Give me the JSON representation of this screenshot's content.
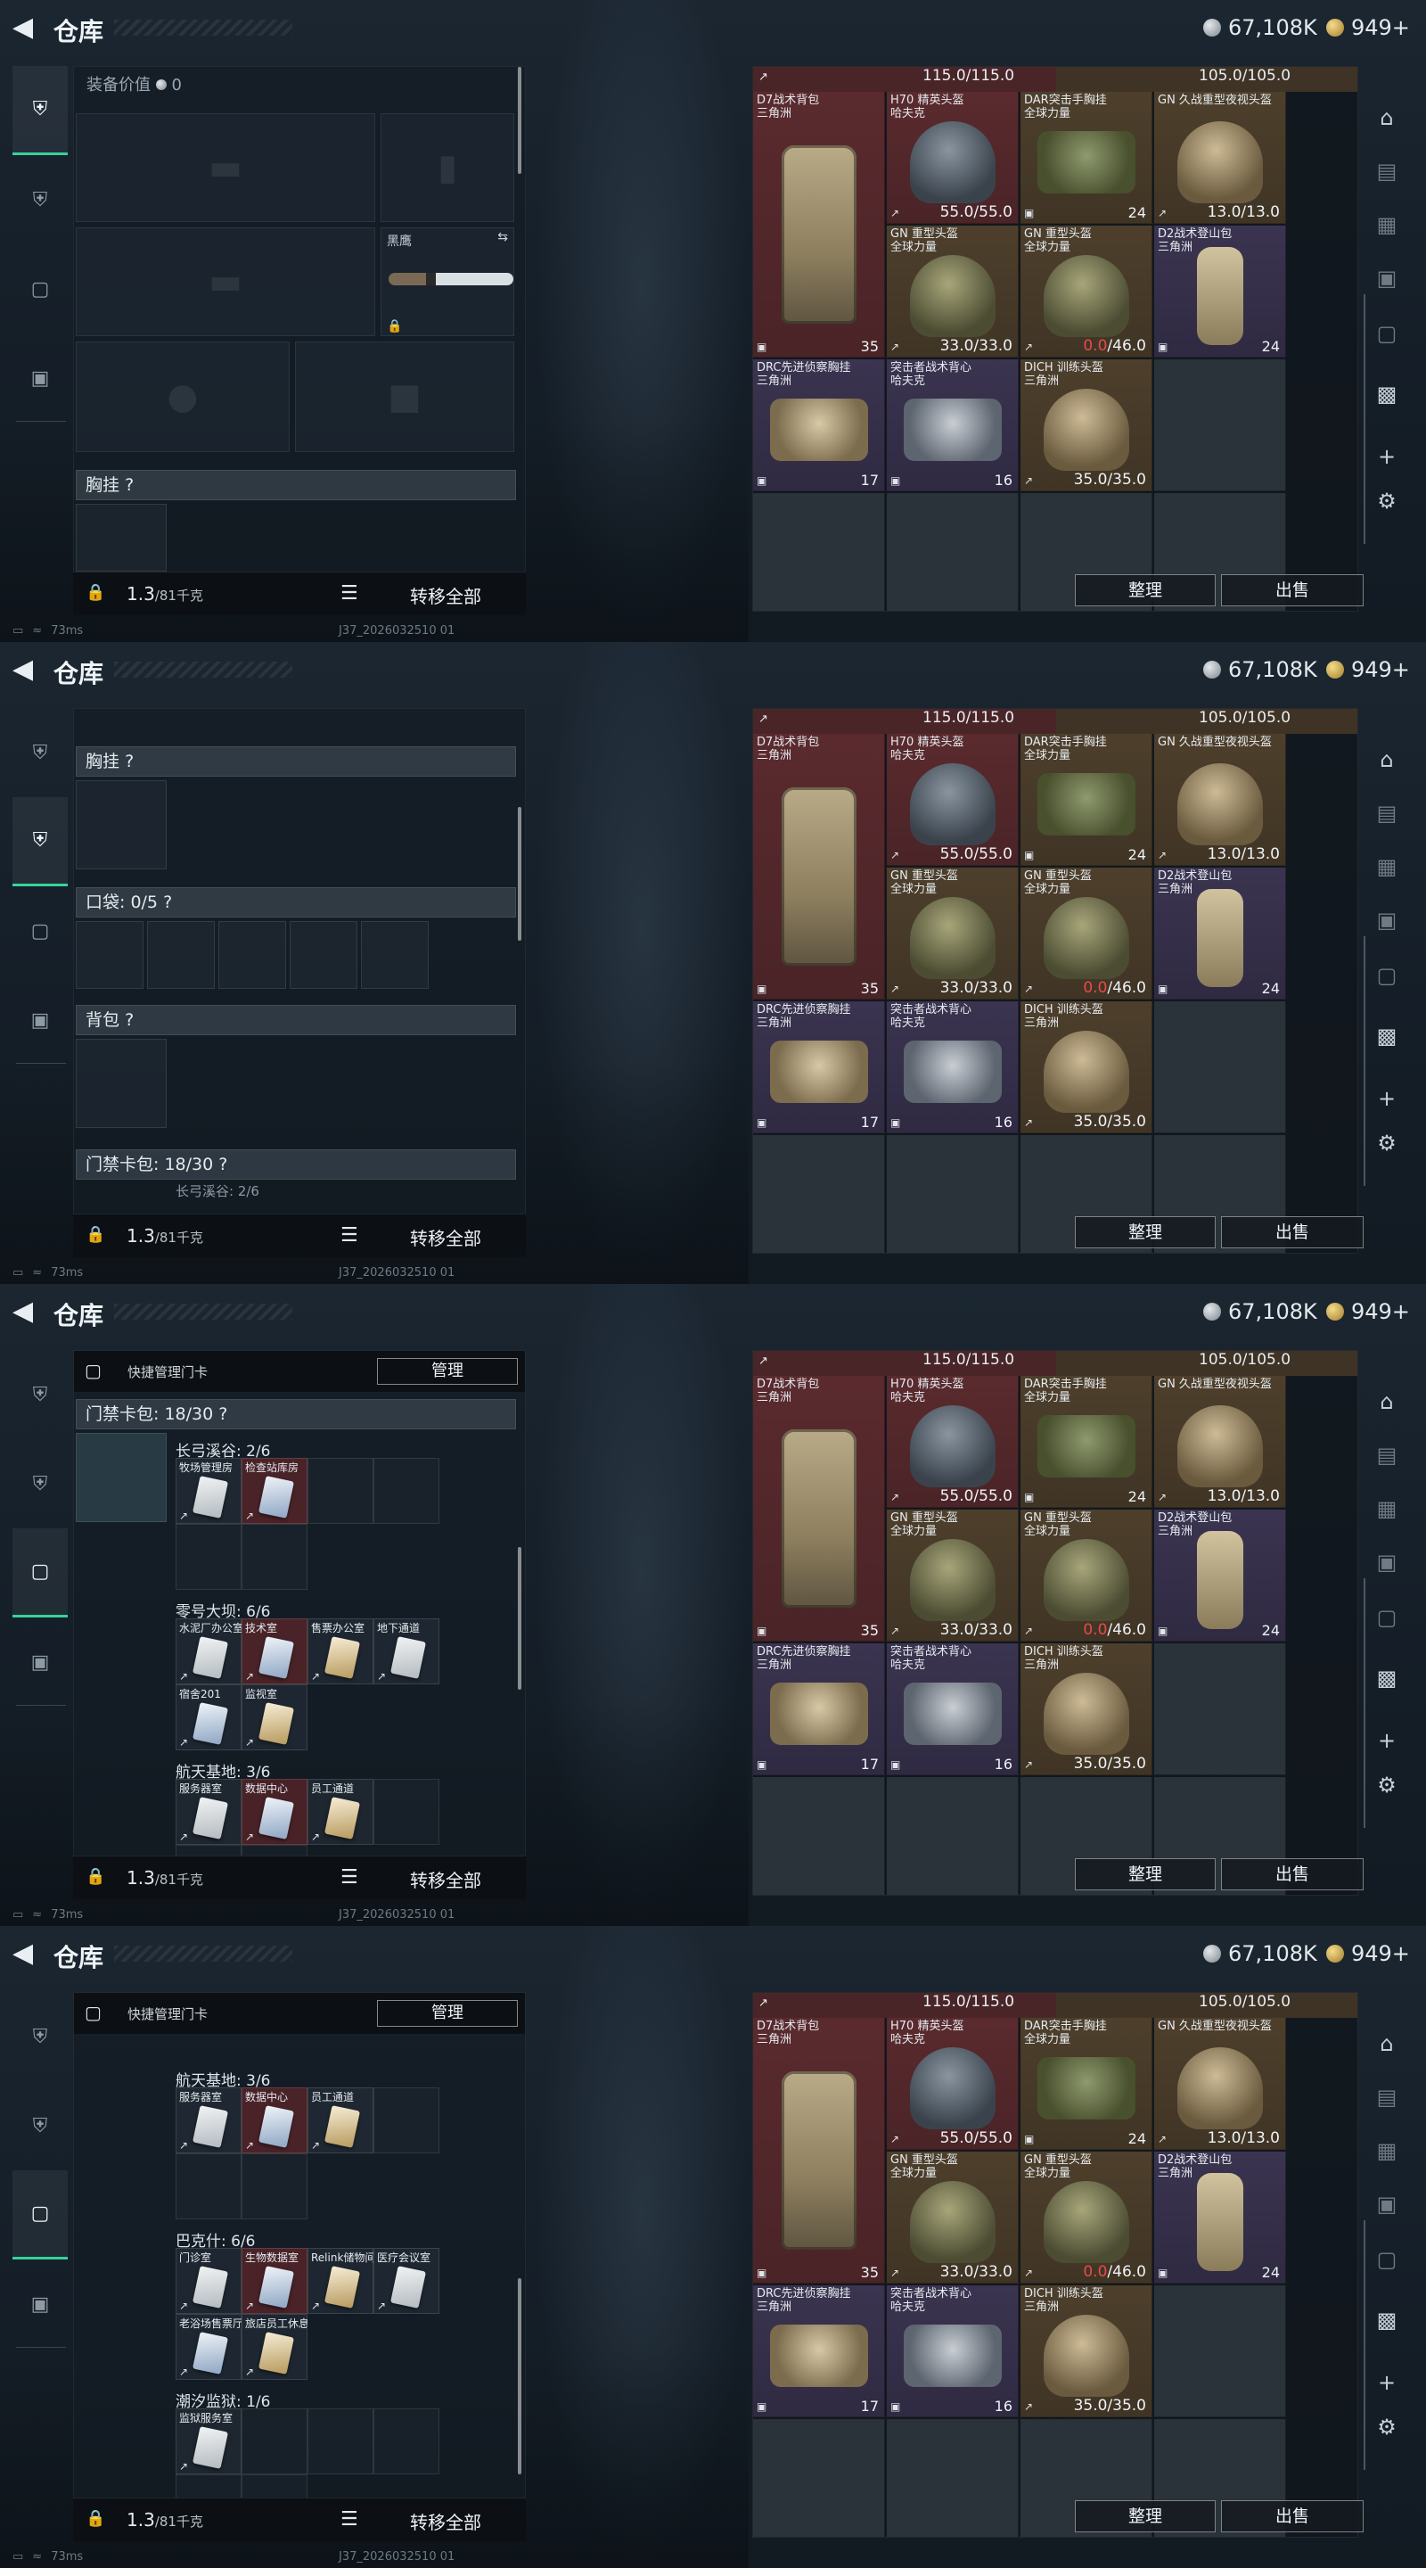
{
  "header": {
    "title": "仓库",
    "silver": "67,108K",
    "gold": "949+"
  },
  "rail": [
    "weapon-icon",
    "armor-icon",
    "keycard-icon",
    "briefcase-icon"
  ],
  "panel": {
    "value_label": "装备价值",
    "value": "0",
    "chest_label": "胸挂",
    "pocket_label": "口袋: 0/5",
    "bag_label": "背包",
    "card_label": "门禁卡包: 18/30",
    "card_sub": "长弓溪谷: 2/6",
    "knife_label": "黑鹰",
    "help": "?"
  },
  "footer": {
    "weight": "1.3",
    "weight_cap": "/81千克",
    "transfer": "转移全部"
  },
  "keycards": {
    "quick_manage": "快捷管理门卡",
    "manage_btn": "管理",
    "groups_f3": [
      {
        "label": "长弓溪谷: 2/6",
        "cards": [
          "牧场管理房",
          "检查站库房"
        ]
      },
      {
        "label": "零号大坝: 6/6",
        "cards": [
          "水泥厂办公室",
          "技术室",
          "售票办公室",
          "地下通道",
          "宿舍201",
          "监视室"
        ]
      },
      {
        "label": "航天基地: 3/6",
        "cards": [
          "服务器室",
          "数据中心",
          "员工通道"
        ]
      }
    ],
    "groups_f4": [
      {
        "label": "航天基地: 3/6",
        "cards": [
          "服务器室",
          "数据中心",
          "员工通道"
        ]
      },
      {
        "label": "巴克什: 6/6",
        "cards": [
          "门诊室",
          "生物数据室",
          "Relink储物间",
          "医疗会议室",
          "老浴场售票厅",
          "旅店员工休息室"
        ]
      },
      {
        "label": "潮汐监狱: 1/6",
        "cards": [
          "监狱服务室"
        ]
      }
    ]
  },
  "storage": {
    "strip_left": "115.0/115.0",
    "strip_right": "105.0/105.0",
    "items": [
      {
        "name": "D7战术背包\n三角洲",
        "value": "35",
        "kind": "bag"
      },
      {
        "name": "H70 精英头盔\n哈夫克",
        "value": "55.0/55.0",
        "kind": "helm"
      },
      {
        "name": "DAR突击手胸挂\n全球力量",
        "value": "24",
        "kind": "vest"
      },
      {
        "name": "GN 久战重型夜视头盔",
        "value": "13.0/13.0",
        "kind": "helm-tan"
      },
      {
        "name": "GN 重型头盔\n全球力量",
        "value": "33.0/33.0",
        "kind": "helm-olive"
      },
      {
        "name": "GN 重型头盔\n全球力量",
        "value_a": "0.0",
        "value_b": "/46.0",
        "kind": "helm-olive"
      },
      {
        "name": "D2战术登山包\n三角洲",
        "value": "24",
        "kind": "pack"
      },
      {
        "name": "DRC先进侦察胸挂\n三角洲",
        "value": "17",
        "kind": "vest-tan"
      },
      {
        "name": "突击者战术背心\n哈夫克",
        "value": "16",
        "kind": "vest-gray"
      },
      {
        "name": "DICH 训练头盔\n三角洲",
        "value": "35.0/35.0",
        "kind": "helm-tan"
      }
    ],
    "sort": "整理",
    "sell": "出售"
  },
  "status": {
    "ping": "73ms",
    "build": "J37_2026032510 01"
  },
  "colors": {
    "accent": "#37d29b",
    "red_value": "#e84a4a"
  }
}
